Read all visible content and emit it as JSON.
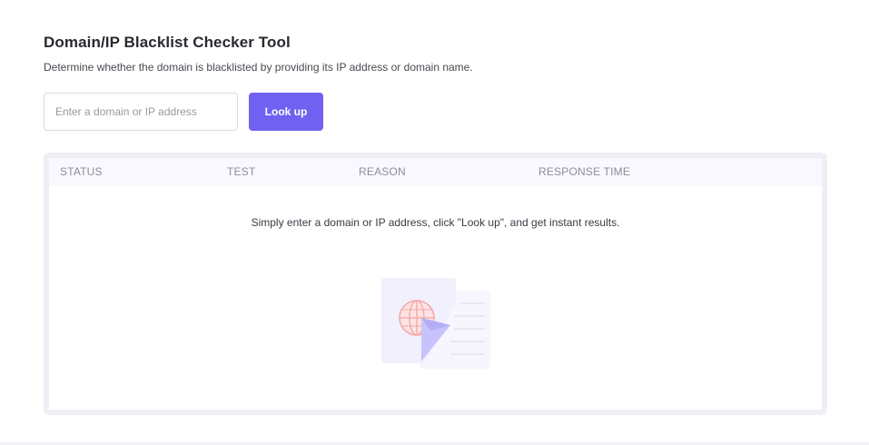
{
  "page": {
    "title": "Domain/IP Blacklist Checker Tool",
    "subtitle": "Determine whether the domain is blacklisted by providing its IP address or domain name."
  },
  "search": {
    "placeholder": "Enter a domain or IP address",
    "value": "",
    "button_label": "Look up"
  },
  "table": {
    "columns": [
      "STATUS",
      "TEST",
      "REASON",
      "RESPONSE TIME"
    ],
    "rows": [],
    "empty_message": "Simply enter a domain or IP address, click \"Look up\", and get instant results."
  },
  "colors": {
    "accent": "#7161f0",
    "panel_border": "#efeff6",
    "header_bg": "#f9f8fe",
    "globe_accent": "#f4a5a5"
  },
  "icons": {
    "empty_state": "document-globe-illustration"
  }
}
